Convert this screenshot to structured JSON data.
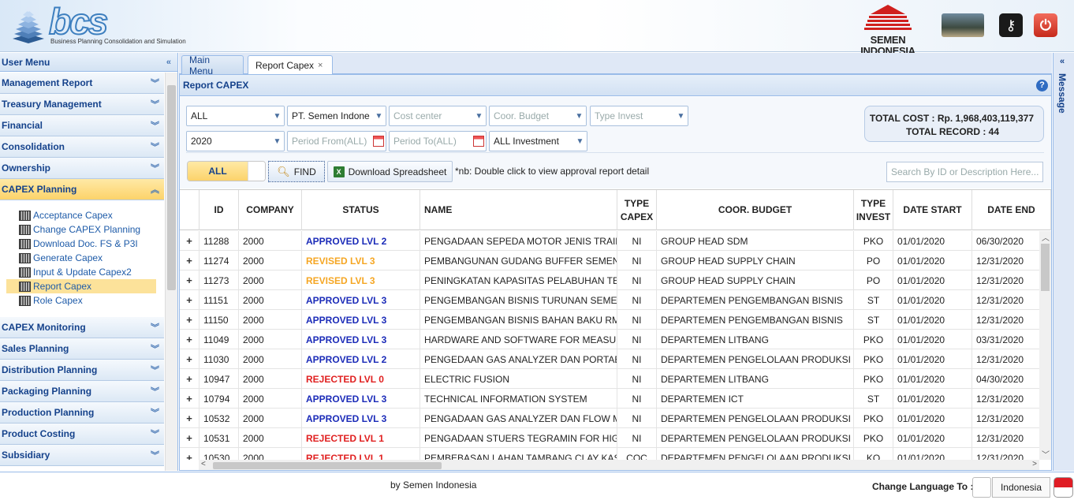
{
  "header": {
    "logo_text": "bcs",
    "logo_subtitle": "Business Planning Consolidation and Simulation",
    "company_logo_line1": "SEMEN",
    "company_logo_line2": "INDONESIA",
    "icons": [
      "user-photo",
      "key-icon",
      "power-icon"
    ]
  },
  "sidebar": {
    "title": "User Menu",
    "groups_top": [
      "Management Report",
      "Treasury Management",
      "Financial",
      "Consolidation",
      "Ownership"
    ],
    "active_group": "CAPEX Planning",
    "sub_items": [
      "Acceptance Capex",
      "Change CAPEX Planning",
      "Download Doc. FS & P3I",
      "Generate Capex",
      "Input & Update Capex2",
      "Report Capex",
      "Role Capex"
    ],
    "selected_sub": "Report Capex",
    "groups_bottom": [
      "CAPEX Monitoring",
      "Sales Planning",
      "Distribution Planning",
      "Packaging Planning",
      "Production Planning",
      "Product Costing",
      "Subsidiary"
    ]
  },
  "tabs": [
    {
      "label": "Main Menu",
      "active": false
    },
    {
      "label": "Report Capex",
      "active": true,
      "close": "×"
    }
  ],
  "panel": {
    "title": "Report CAPEX",
    "help": "?"
  },
  "filters": {
    "row1": [
      {
        "value": "ALL",
        "placeholder": false
      },
      {
        "value": "PT. Semen Indone",
        "placeholder": false
      },
      {
        "value": "Cost center",
        "placeholder": true
      },
      {
        "value": "Coor. Budget",
        "placeholder": true
      },
      {
        "value": "Type Invest",
        "placeholder": true
      }
    ],
    "row2": [
      {
        "value": "2020",
        "placeholder": false,
        "kind": "combo"
      },
      {
        "value": "Period From(ALL)",
        "placeholder": true,
        "kind": "date"
      },
      {
        "value": "Period To(ALL)",
        "placeholder": true,
        "kind": "date"
      },
      {
        "value": "ALL Investment",
        "placeholder": false,
        "kind": "combo"
      }
    ]
  },
  "totals": {
    "cost": "TOTAL COST : Rp. 1,968,403,119,377",
    "record": "TOTAL RECORD : 44"
  },
  "toolbar": {
    "toggle_label": "ALL",
    "find_label": "FIND",
    "download_label": "Download Spreadsheet",
    "note": "*nb: Double click to view approval report detail",
    "search_placeholder": "Search By ID or Description Here..."
  },
  "status_colors": {
    "APPROVED": "#1b2bb8",
    "REVISED": "#f5a623",
    "REJECTED": "#e02020"
  },
  "table": {
    "columns": [
      "",
      "ID",
      "COMPANY",
      "STATUS",
      "NAME",
      "TYPE CAPEX",
      "COOR. BUDGET",
      "TYPE INVEST",
      "DATE START",
      "DATE END"
    ],
    "rows": [
      {
        "id": "11288",
        "company": "2000",
        "status": "APPROVED LVL 2",
        "status_type": "APPROVED",
        "name": "PENGADAAN SEPEDA MOTOR JENIS TRAIL",
        "type_capex": "NI",
        "coor_budget": "GROUP HEAD SDM",
        "type_invest": "PKO",
        "date_start": "01/01/2020",
        "date_end": "06/30/2020"
      },
      {
        "id": "11274",
        "company": "2000",
        "status": "REVISED LVL 3",
        "status_type": "REVISED",
        "name": "PEMBANGUNAN GUDANG BUFFER SEMEN",
        "type_capex": "NI",
        "coor_budget": "GROUP HEAD SUPPLY CHAIN",
        "type_invest": "PO",
        "date_start": "01/01/2020",
        "date_end": "12/31/2020"
      },
      {
        "id": "11273",
        "company": "2000",
        "status": "REVISED LVL 3",
        "status_type": "REVISED",
        "name": "PENINGKATAN KAPASITAS PELABUHAN TER",
        "type_capex": "NI",
        "coor_budget": "GROUP HEAD SUPPLY CHAIN",
        "type_invest": "PO",
        "date_start": "01/01/2020",
        "date_end": "12/31/2020"
      },
      {
        "id": "11151",
        "company": "2000",
        "status": "APPROVED LVL 3",
        "status_type": "APPROVED",
        "name": "PENGEMBANGAN BISNIS TURUNAN SEMEN",
        "type_capex": "NI",
        "coor_budget": "DEPARTEMEN PENGEMBANGAN BISNIS",
        "type_invest": "ST",
        "date_start": "01/01/2020",
        "date_end": "12/31/2020"
      },
      {
        "id": "11150",
        "company": "2000",
        "status": "APPROVED LVL 3",
        "status_type": "APPROVED",
        "name": "PENGEMBANGAN BISNIS BAHAN BAKU RMX",
        "type_capex": "NI",
        "coor_budget": "DEPARTEMEN PENGEMBANGAN BISNIS",
        "type_invest": "ST",
        "date_start": "01/01/2020",
        "date_end": "12/31/2020"
      },
      {
        "id": "11049",
        "company": "2000",
        "status": "APPROVED LVL 3",
        "status_type": "APPROVED",
        "name": "HARDWARE AND SOFTWARE FOR MEASUR",
        "type_capex": "NI",
        "coor_budget": "DEPARTEMEN LITBANG",
        "type_invest": "PKO",
        "date_start": "01/01/2020",
        "date_end": "03/31/2020"
      },
      {
        "id": "11030",
        "company": "2000",
        "status": "APPROVED LVL 2",
        "status_type": "APPROVED",
        "name": "PENGEDAAN GAS ANALYZER DAN PORTABL",
        "type_capex": "NI",
        "coor_budget": "DEPARTEMEN PENGELOLAAN PRODUKSI",
        "type_invest": "PKO",
        "date_start": "01/01/2020",
        "date_end": "12/31/2020"
      },
      {
        "id": "10947",
        "company": "2000",
        "status": "REJECTED LVL 0",
        "status_type": "REJECTED",
        "name": "ELECTRIC FUSION",
        "type_capex": "NI",
        "coor_budget": "DEPARTEMEN LITBANG",
        "type_invest": "PKO",
        "date_start": "01/01/2020",
        "date_end": "04/30/2020"
      },
      {
        "id": "10794",
        "company": "2000",
        "status": "APPROVED LVL 3",
        "status_type": "APPROVED",
        "name": "TECHNICAL INFORMATION SYSTEM",
        "type_capex": "NI",
        "coor_budget": "DEPARTEMEN ICT",
        "type_invest": "ST",
        "date_start": "01/01/2020",
        "date_end": "12/31/2020"
      },
      {
        "id": "10532",
        "company": "2000",
        "status": "APPROVED LVL 3",
        "status_type": "APPROVED",
        "name": "PENGADAAN GAS ANALYZER DAN FLOW ME",
        "type_capex": "NI",
        "coor_budget": "DEPARTEMEN PENGELOLAAN PRODUKSI",
        "type_invest": "PKO",
        "date_start": "01/01/2020",
        "date_end": "12/31/2020"
      },
      {
        "id": "10531",
        "company": "2000",
        "status": "REJECTED LVL 1",
        "status_type": "REJECTED",
        "name": "PENGADAAN STUERS TEGRAMIN FOR HIGH",
        "type_capex": "NI",
        "coor_budget": "DEPARTEMEN PENGELOLAAN PRODUKSI",
        "type_invest": "PKO",
        "date_start": "01/01/2020",
        "date_end": "12/31/2020"
      },
      {
        "id": "10530",
        "company": "2000",
        "status": "REJECTED LVL 1",
        "status_type": "REJECTED",
        "name": "PEMBEBASAN LAHAN TAMBANG CLAY KASIM",
        "type_capex": "COC",
        "coor_budget": "DEPARTEMEN PENGELOLAAN PRODUKSI",
        "type_invest": "KO",
        "date_start": "01/01/2020",
        "date_end": "12/31/2020"
      }
    ]
  },
  "message_panel": {
    "label": "Message"
  },
  "footer": {
    "by": "by Semen Indonesia",
    "change_language_label": "Change Language To :",
    "language": "Indonesia"
  }
}
